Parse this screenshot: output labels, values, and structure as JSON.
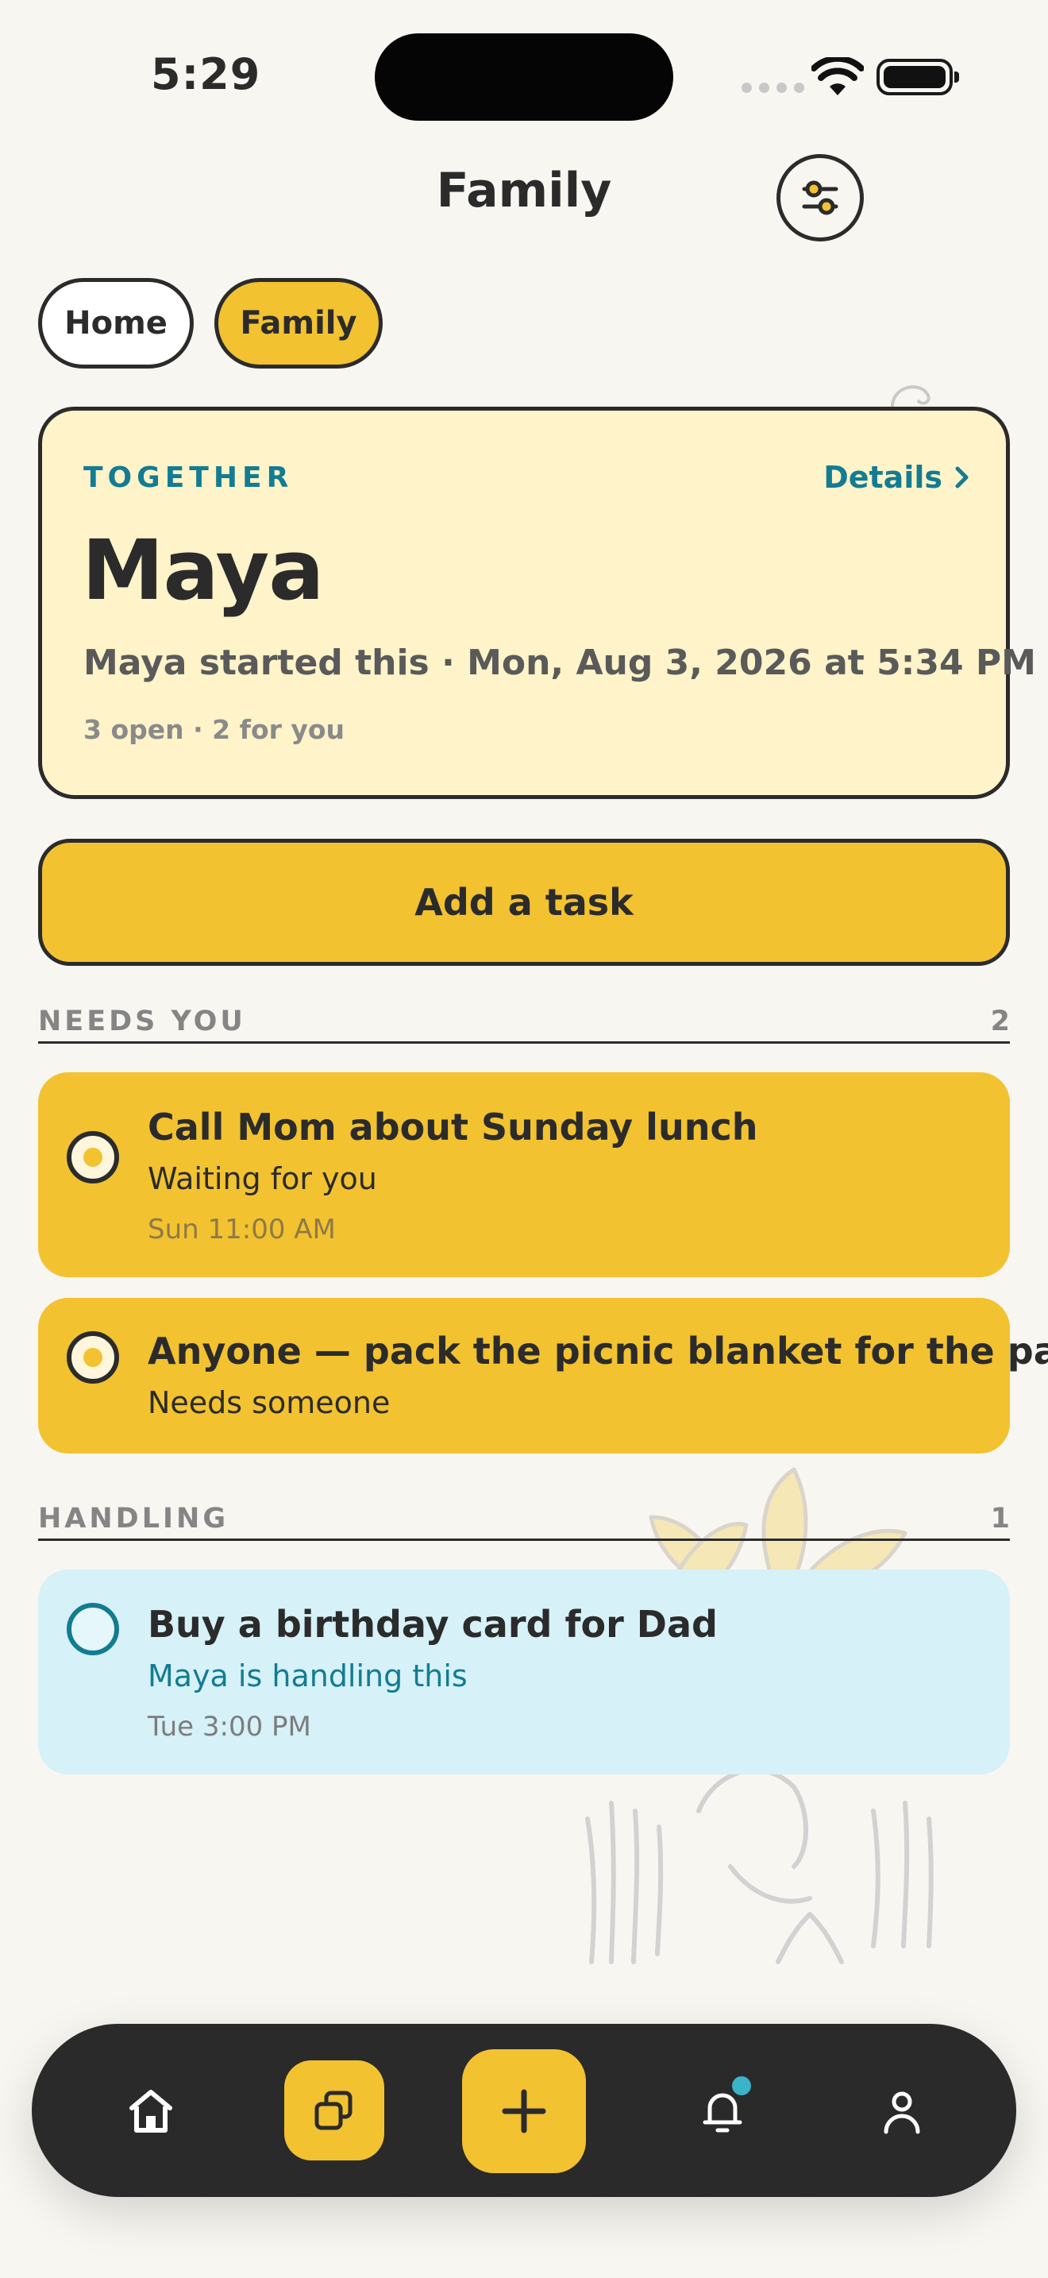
{
  "status_bar": {
    "time": "5:29"
  },
  "header": {
    "title": "Family"
  },
  "tabs": [
    {
      "label": "Home",
      "selected": false
    },
    {
      "label": "Family",
      "selected": true
    }
  ],
  "hero": {
    "eyebrow": "TOGETHER",
    "details_label": "Details",
    "name": "Maya",
    "meta": "Maya started this · Mon, Aug 3, 2026 at 5:34 PM",
    "counts": "3 open · 2 for you"
  },
  "add_task_label": "Add a task",
  "sections": {
    "needs_you": {
      "label": "NEEDS YOU",
      "count": "2",
      "tasks": [
        {
          "title": "Call Mom about Sunday lunch",
          "status": "Waiting for you",
          "time": "Sun 11:00 AM"
        },
        {
          "title": "Anyone — pack the picnic blanket for the park",
          "status": "Needs someone"
        }
      ]
    },
    "handling": {
      "label": "HANDLING",
      "count": "1",
      "tasks": [
        {
          "title": "Buy a birthday card for Dad",
          "status": "Maya is handling this",
          "time": "Tue 3:00 PM"
        }
      ]
    }
  },
  "nav": {
    "items": [
      {
        "icon": "home-icon"
      },
      {
        "icon": "groups-icon",
        "selected": true
      },
      {
        "icon": "plus-icon"
      },
      {
        "icon": "bell-icon",
        "has_badge": true
      },
      {
        "icon": "profile-icon"
      }
    ]
  },
  "colors": {
    "accent_yellow": "#f2c230",
    "teal": "#137c92",
    "card_cream": "#fef3c9",
    "card_blue": "#d6f1f8",
    "background": "#f8f6f1",
    "dark": "#2b2b2b"
  }
}
